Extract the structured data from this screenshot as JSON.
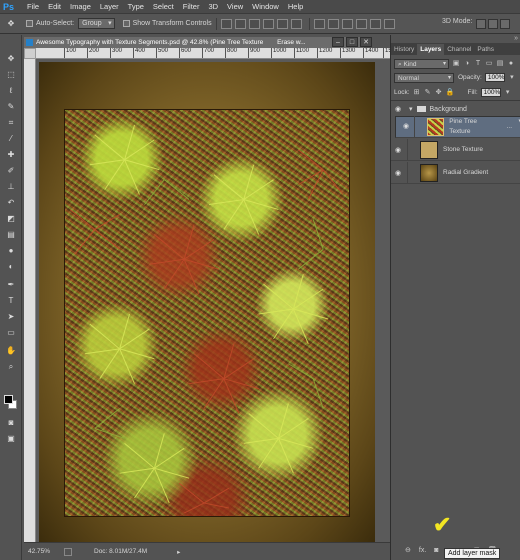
{
  "app": {
    "logo": "Ps"
  },
  "menu": [
    "File",
    "Edit",
    "Image",
    "Layer",
    "Type",
    "Select",
    "Filter",
    "3D",
    "View",
    "Window",
    "Help"
  ],
  "options_bar": {
    "auto_select_label": "Auto-Select:",
    "auto_select_value": "Group",
    "show_transform_label": "Show Transform Controls",
    "mode_3d_label": "3D Mode:"
  },
  "document": {
    "tab_title": "Awesome Typography with Texture Segments.psd @ 42.8% (Pine Tree Texture",
    "tab_extra": "Erase w...",
    "ruler_ticks": [
      "100",
      "200",
      "300",
      "400",
      "500",
      "600",
      "700",
      "800",
      "900",
      "1000",
      "1100",
      "1200",
      "1300",
      "1400",
      "15"
    ]
  },
  "status": {
    "zoom": "42.75%",
    "doc_info": "Doc: 8.01M/27.4M"
  },
  "panels": {
    "tabs": [
      "History",
      "Layers",
      "Channel",
      "Paths"
    ],
    "active_tab": "Layers",
    "kind_label": "Kind",
    "blend_mode": "Normal",
    "opacity_label": "Opacity:",
    "opacity_value": "100%",
    "lock_label": "Lock:",
    "fill_label": "Fill:",
    "fill_value": "100%",
    "group_name": "Background",
    "layers": [
      {
        "name": "Pine Tree Texture",
        "selected": true,
        "suffix": "..."
      },
      {
        "name": "Stone Texture",
        "selected": false
      },
      {
        "name": "Radial Gradient",
        "selected": false
      }
    ],
    "footer_fx": "fx."
  },
  "tooltip": {
    "text": "Add layer mask"
  },
  "colors": {
    "menubar": "#4a4a4a",
    "panel_bg": "#535353",
    "selected_layer": "#5f6d80",
    "checkmark": "#f3e623",
    "ps_blue": "#2fa3ff"
  },
  "icons": {
    "tools": [
      "move-icon",
      "marquee-icon",
      "lasso-icon",
      "quick-select-icon",
      "crop-icon",
      "eyedropper-icon",
      "spot-heal-icon",
      "brush-icon",
      "clone-stamp-icon",
      "history-brush-icon",
      "eraser-icon",
      "gradient-icon",
      "blur-icon",
      "dodge-icon",
      "pen-icon",
      "type-icon",
      "path-select-icon",
      "shape-icon",
      "hand-icon",
      "zoom-icon"
    ]
  }
}
